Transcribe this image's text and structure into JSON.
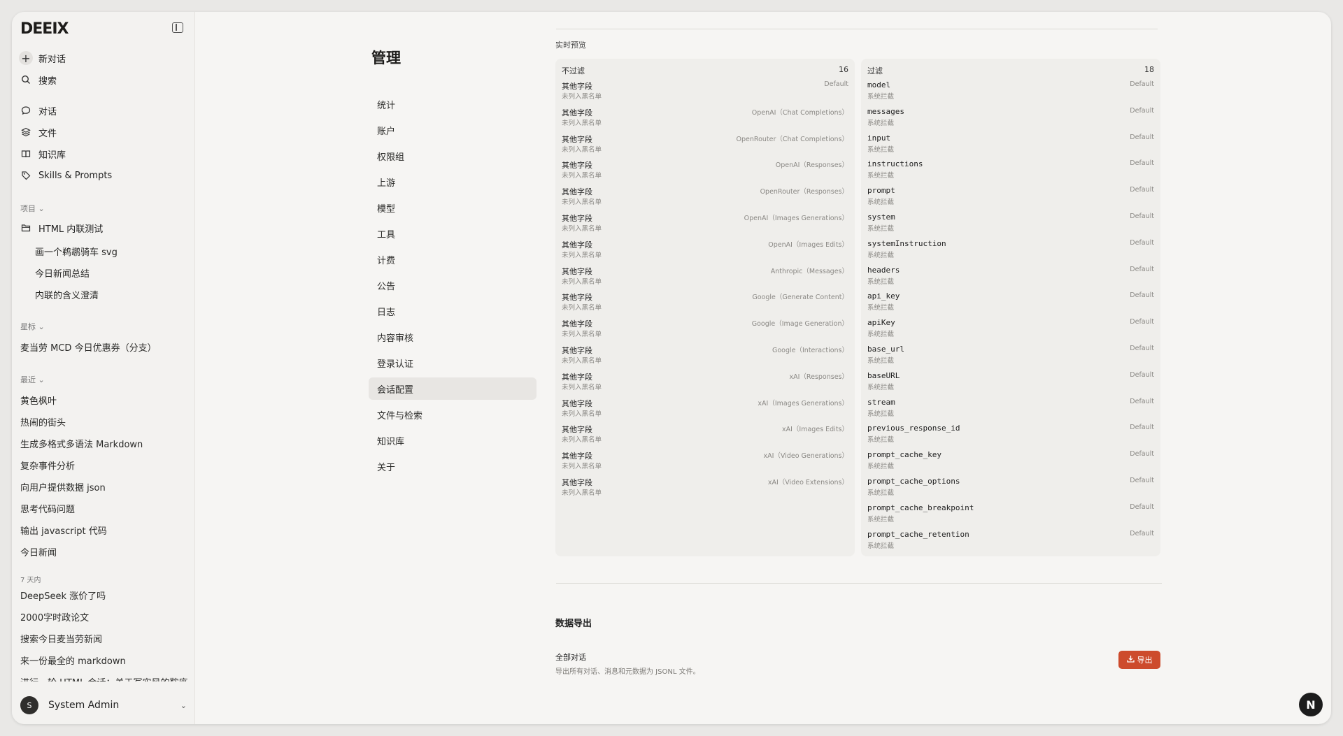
{
  "sidebar": {
    "logo": "DEEIX",
    "new_chat": "新对话",
    "search": "搜索",
    "nav": [
      {
        "label": "对话",
        "icon": "chat-bubble-icon"
      },
      {
        "label": "文件",
        "icon": "layers-icon"
      },
      {
        "label": "知识库",
        "icon": "book-icon"
      },
      {
        "label": "Skills & Prompts",
        "icon": "tags-icon"
      }
    ],
    "projects_label": "项目",
    "project_name": "HTML 内联测试",
    "project_chats": [
      "画一个鹈鹕骑车 svg",
      "今日新闻总结",
      "内联的含义澄清"
    ],
    "starred_label": "星标",
    "starred": [
      "麦当劳 MCD 今日优惠券（分支）"
    ],
    "recent_label": "最近",
    "recent": [
      "黄色枫叶",
      "热闹的街头",
      "生成多格式多语法 Markdown",
      "复杂事件分析",
      "向用户提供数据 json",
      "思考代码问题",
      "输出 javascript 代码",
      "今日新闻"
    ],
    "week_label": "7 天内",
    "week": [
      "DeepSeek 涨价了吗",
      "2000字时政论文",
      "搜索今日麦当劳新闻",
      "来一份最全的 markdown",
      "进行一轮 HTML 会话：关于写实风的鞍座"
    ],
    "user": {
      "initial": "S",
      "name": "System Admin"
    }
  },
  "admin": {
    "title": "管理",
    "nav": [
      "统计",
      "账户",
      "权限组",
      "上游",
      "模型",
      "工具",
      "计费",
      "公告",
      "日志",
      "内容审核",
      "登录认证",
      "会话配置",
      "文件与检索",
      "知识库",
      "关于"
    ],
    "active": "会话配置"
  },
  "preview": {
    "label": "实时预览",
    "left": {
      "title": "不过滤",
      "count": "16",
      "rows": [
        {
          "name": "其他字段",
          "sub": "未列入黑名单",
          "tag": "Default"
        },
        {
          "name": "其他字段",
          "sub": "未列入黑名单",
          "tag": "OpenAI（Chat Completions）"
        },
        {
          "name": "其他字段",
          "sub": "未列入黑名单",
          "tag": "OpenRouter（Chat Completions）"
        },
        {
          "name": "其他字段",
          "sub": "未列入黑名单",
          "tag": "OpenAI（Responses）"
        },
        {
          "name": "其他字段",
          "sub": "未列入黑名单",
          "tag": "OpenRouter（Responses）"
        },
        {
          "name": "其他字段",
          "sub": "未列入黑名单",
          "tag": "OpenAI（Images Generations）"
        },
        {
          "name": "其他字段",
          "sub": "未列入黑名单",
          "tag": "OpenAI（Images Edits）"
        },
        {
          "name": "其他字段",
          "sub": "未列入黑名单",
          "tag": "Anthropic（Messages）"
        },
        {
          "name": "其他字段",
          "sub": "未列入黑名单",
          "tag": "Google（Generate Content）"
        },
        {
          "name": "其他字段",
          "sub": "未列入黑名单",
          "tag": "Google（Image Generation）"
        },
        {
          "name": "其他字段",
          "sub": "未列入黑名单",
          "tag": "Google（Interactions）"
        },
        {
          "name": "其他字段",
          "sub": "未列入黑名单",
          "tag": "xAI（Responses）"
        },
        {
          "name": "其他字段",
          "sub": "未列入黑名单",
          "tag": "xAI（Images Generations）"
        },
        {
          "name": "其他字段",
          "sub": "未列入黑名单",
          "tag": "xAI（Images Edits）"
        },
        {
          "name": "其他字段",
          "sub": "未列入黑名单",
          "tag": "xAI（Video Generations）"
        },
        {
          "name": "其他字段",
          "sub": "未列入黑名单",
          "tag": "xAI（Video Extensions）"
        }
      ]
    },
    "right": {
      "title": "过滤",
      "count": "18",
      "rows": [
        {
          "name": "model",
          "sub": "系统拦截",
          "tag": "Default"
        },
        {
          "name": "messages",
          "sub": "系统拦截",
          "tag": "Default"
        },
        {
          "name": "input",
          "sub": "系统拦截",
          "tag": "Default"
        },
        {
          "name": "instructions",
          "sub": "系统拦截",
          "tag": "Default"
        },
        {
          "name": "prompt",
          "sub": "系统拦截",
          "tag": "Default"
        },
        {
          "name": "system",
          "sub": "系统拦截",
          "tag": "Default"
        },
        {
          "name": "systemInstruction",
          "sub": "系统拦截",
          "tag": "Default"
        },
        {
          "name": "headers",
          "sub": "系统拦截",
          "tag": "Default"
        },
        {
          "name": "api_key",
          "sub": "系统拦截",
          "tag": "Default"
        },
        {
          "name": "apiKey",
          "sub": "系统拦截",
          "tag": "Default"
        },
        {
          "name": "base_url",
          "sub": "系统拦截",
          "tag": "Default"
        },
        {
          "name": "baseURL",
          "sub": "系统拦截",
          "tag": "Default"
        },
        {
          "name": "stream",
          "sub": "系统拦截",
          "tag": "Default"
        },
        {
          "name": "previous_response_id",
          "sub": "系统拦截",
          "tag": "Default"
        },
        {
          "name": "prompt_cache_key",
          "sub": "系统拦截",
          "tag": "Default"
        },
        {
          "name": "prompt_cache_options",
          "sub": "系统拦截",
          "tag": "Default"
        },
        {
          "name": "prompt_cache_breakpoint",
          "sub": "系统拦截",
          "tag": "Default"
        },
        {
          "name": "prompt_cache_retention",
          "sub": "系统拦截",
          "tag": "Default"
        }
      ]
    }
  },
  "export": {
    "title": "数据导出",
    "item": "全部对话",
    "desc": "导出所有对话、消息和元数据为 JSONL 文件。",
    "button": "导出"
  },
  "fab": "N"
}
